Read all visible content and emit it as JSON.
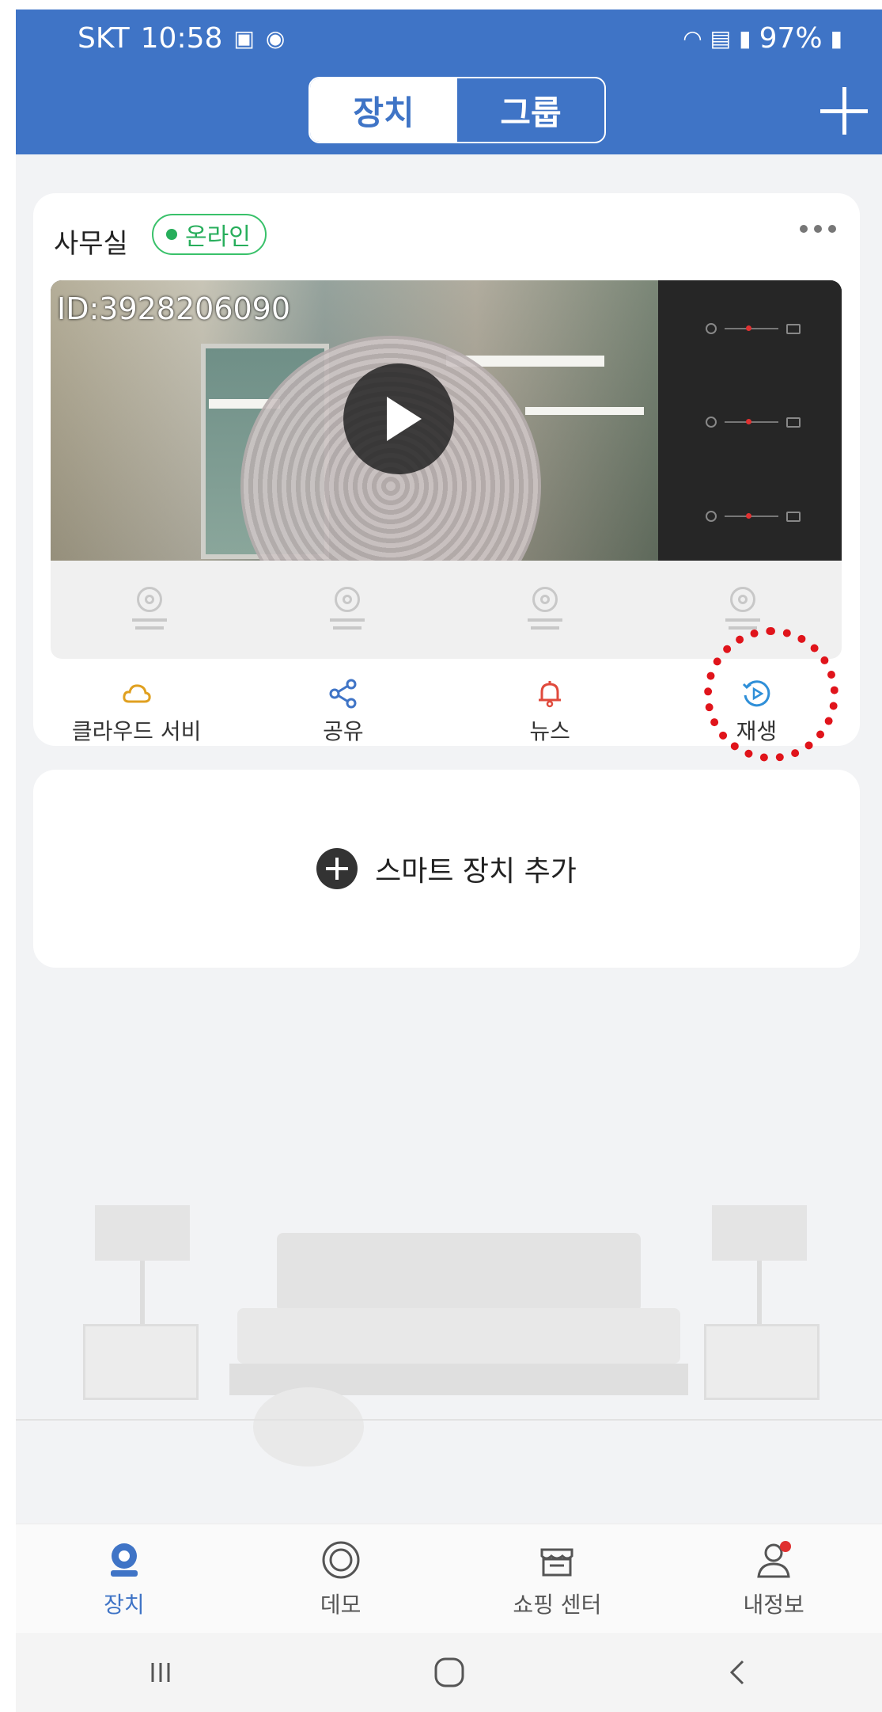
{
  "status_bar": {
    "carrier": "SKT",
    "time": "10:58",
    "battery": "97%",
    "icons": [
      "gallery-icon",
      "camera-app-icon",
      "wifi-icon",
      "hd-voice-icon",
      "signal-icon",
      "battery-icon"
    ]
  },
  "header": {
    "tabs": [
      {
        "label": "장치",
        "active": true
      },
      {
        "label": "그룹",
        "active": false
      }
    ],
    "add_icon": "plus-icon",
    "accent_color": "#3f74c6"
  },
  "device_card": {
    "name": "사무실",
    "status": "온라인",
    "status_color": "#27ae5b",
    "video_id": "ID:3928206090",
    "more_icon": "more-dots-icon",
    "actions": [
      {
        "label": "클라우드 서비",
        "icon": "cloud-icon",
        "color": "#e0a020"
      },
      {
        "label": "공유",
        "icon": "share-icon",
        "color": "#3f74c6"
      },
      {
        "label": "뉴스",
        "icon": "bell-icon",
        "color": "#e04a3c"
      },
      {
        "label": "재생",
        "icon": "replay-icon",
        "color": "#2f8fd8"
      }
    ]
  },
  "add_device": {
    "label": "스마트 장치 추가"
  },
  "bottom_nav": [
    {
      "label": "장치",
      "icon": "device-icon",
      "active": true
    },
    {
      "label": "데모",
      "icon": "demo-icon",
      "active": false
    },
    {
      "label": "쇼핑 센터",
      "icon": "shop-icon",
      "active": false
    },
    {
      "label": "내정보",
      "icon": "profile-icon",
      "active": false
    }
  ]
}
